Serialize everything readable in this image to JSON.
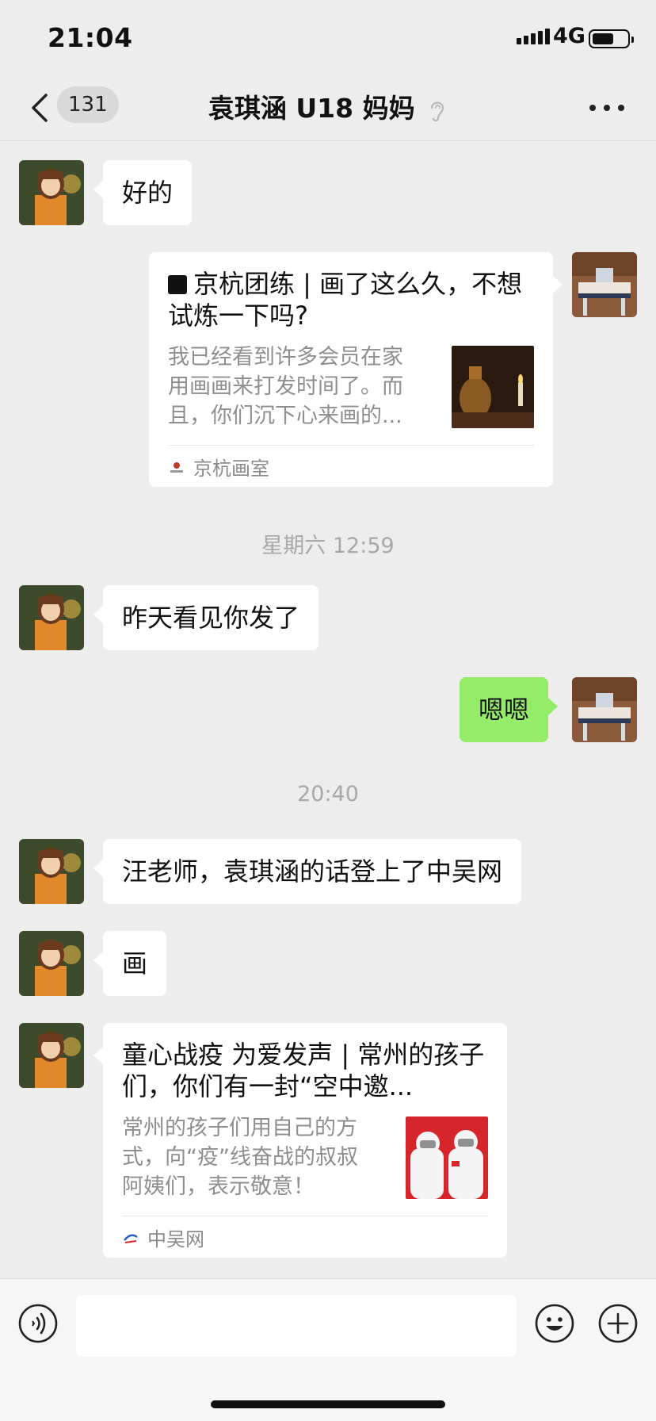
{
  "status_bar": {
    "time": "21:04",
    "network": "4G",
    "battery_fraction": 0.6
  },
  "nav": {
    "unread_count": "131",
    "title": "袁琪涵 U18 妈妈",
    "back_icon": "chevron-left-icon",
    "mute_icon": "ear-icon",
    "more_icon": "more-dots-icon"
  },
  "messages": [
    {
      "side": "left",
      "type": "text",
      "text": "好的"
    },
    {
      "side": "right",
      "type": "link-card",
      "title": "京杭团练 | 画了这么久，不想试炼一下吗?",
      "description": "我已经看到许多会员在家用画画来打发时间了。而且，你们沉下心来画的...",
      "source": "京杭画室"
    },
    {
      "type": "timestamp",
      "text": "星期六 12:59"
    },
    {
      "side": "left",
      "type": "text",
      "text": "昨天看见你发了"
    },
    {
      "side": "right",
      "type": "text",
      "text": "嗯嗯"
    },
    {
      "type": "timestamp",
      "text": "20:40"
    },
    {
      "side": "left",
      "type": "text",
      "text": "汪老师，袁琪涵的话登上了中吴网"
    },
    {
      "side": "left",
      "type": "text",
      "text": "画"
    },
    {
      "side": "left",
      "type": "link-card",
      "title": "童心战疫 为爱发声 | 常州的孩子们，你们有一封“空中邀...",
      "description": "常州的孩子们用自己的方式，向“疫”线奋战的叔叔阿姨们，表示敬意！",
      "source": "中吴网"
    }
  ],
  "input_bar": {
    "voice_icon": "voice-icon",
    "emoji_icon": "emoji-icon",
    "plus_icon": "plus-icon",
    "input_value": ""
  },
  "colors": {
    "background": "#ededed",
    "bubble_self": "#95ec69",
    "bubble_other": "#ffffff",
    "timestamp_text": "#a8a8a8"
  }
}
